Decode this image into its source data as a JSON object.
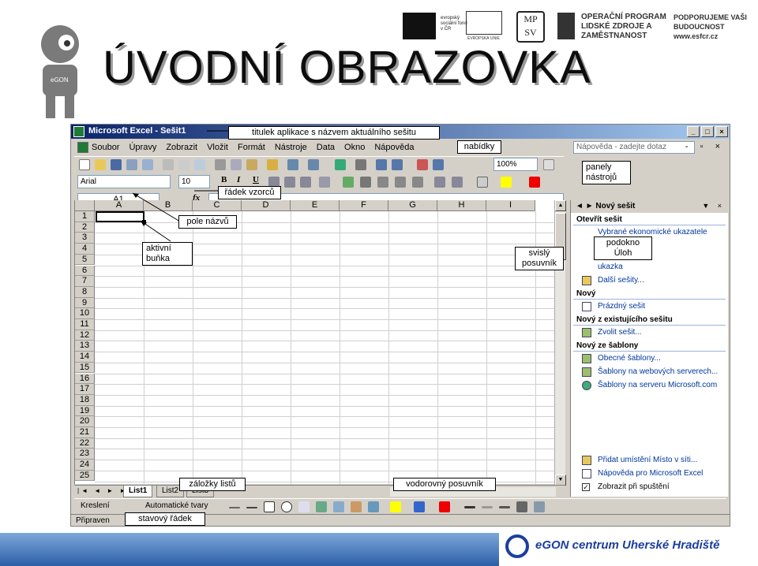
{
  "slide": {
    "title": "ÚVODNÍ OBRAZOVKA",
    "mascot_label": "eGON",
    "footer_text": "eGON centrum Uherské Hradiště"
  },
  "logos": {
    "esf_text": "evropský sociální fond v ČR",
    "eu_text": "EVROPSKÁ UNIE",
    "mpsv": "MP SV",
    "op_text": "OPERAČNÍ PROGRAM LIDSKÉ ZDROJE A ZAMĚSTNANOST",
    "pod_text": "PODPORUJEME VAŠI BUDOUCNOST www.esfcr.cz"
  },
  "excel": {
    "window_title": "Microsoft Excel - Sešit1",
    "menu": [
      "Soubor",
      "Úpravy",
      "Zobrazit",
      "Vložit",
      "Formát",
      "Nástroje",
      "Data",
      "Okno",
      "Nápověda"
    ],
    "help_placeholder": "Nápověda - zadejte dotaz",
    "zoom": "100%",
    "font": "Arial",
    "font_size": "10",
    "name_box": "A1",
    "fx": "fx",
    "columns": [
      "A",
      "B",
      "C",
      "D",
      "E",
      "F",
      "G",
      "H",
      "I"
    ],
    "rows": [
      "1",
      "2",
      "3",
      "4",
      "5",
      "6",
      "7",
      "8",
      "9",
      "10",
      "11",
      "12",
      "13",
      "14",
      "15",
      "16",
      "17",
      "18",
      "19",
      "20",
      "21",
      "22",
      "23",
      "24",
      "25"
    ],
    "tabs": [
      "List1",
      "List2",
      "List3"
    ],
    "draw_label": "Kreslení",
    "autoshapes_label": "Automatické tvary",
    "status": "Připraven"
  },
  "taskpane": {
    "title": "Nový sešit",
    "open_section": "Otevřít sešit",
    "open_links": [
      "Vybrané ekonomické ukazatele",
      "ukazka",
      "Další sešity..."
    ],
    "new_section": "Nový",
    "new_links": [
      "Prázdný sešit"
    ],
    "existing_section": "Nový z existujícího sešitu",
    "existing_links": [
      "Zvolit sešit..."
    ],
    "template_section": "Nový ze šablony",
    "template_links": [
      "Obecné šablony...",
      "Šablony na webových serverech...",
      "Šablony na serveru Microsoft.com"
    ],
    "bottom_links": [
      "Přidat umístění Místo v síti...",
      "Nápověda pro Microsoft Excel"
    ],
    "startup_check": "Zobrazit při spuštění"
  },
  "callouts": {
    "title_bar": "titulek aplikace s názvem aktuálního sešitu",
    "menus": "nabídky",
    "toolbars": "panely nástrojů",
    "formula_bar": "řádek vzorců",
    "name_box": "pole názvů",
    "active_cell": "aktivní buňka",
    "task_pane": "podokno Úloh",
    "vscroll": "svislý posuvník",
    "sheet_tabs": "záložky listů",
    "hscroll": "vodorovný posuvník",
    "status_bar": "stavový řádek"
  }
}
